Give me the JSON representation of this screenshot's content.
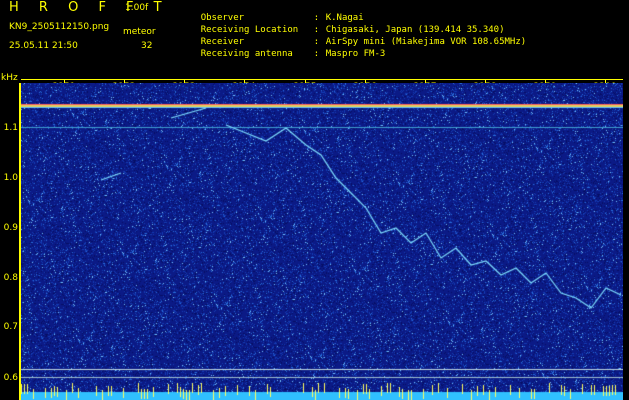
{
  "header": {
    "title": "H R O F F T",
    "version": "1.00f",
    "filename": "KN9_2505112150.png",
    "meteor_label": "meteor",
    "timestamp": "25.05.11 21:50",
    "meteor_count": "32",
    "info": [
      {
        "key": "Observer",
        "value": "K.Nagai"
      },
      {
        "key": "Receiving Location",
        "value": "Chigasaki, Japan (139.414 35.340)"
      },
      {
        "key": "Receiver",
        "value": "AirSpy mini (Miakejima VOR 108.65MHz)"
      },
      {
        "key": "Receiving antenna",
        "value": "Maspro FM-3"
      }
    ]
  },
  "axes": {
    "y_unit": "kHz",
    "y_ticks": [
      "1.1",
      "1.0",
      "0.9",
      "0.8",
      "0.7",
      "0.6"
    ],
    "x_ticks": [
      "2151",
      "2152",
      "2153",
      "2154",
      "2155",
      "2156",
      "2157",
      "2158",
      "2159",
      "2200"
    ]
  },
  "colors": {
    "text": "#ffff00",
    "background": "#0a1a8a",
    "trace": "#7fe0ff"
  }
}
